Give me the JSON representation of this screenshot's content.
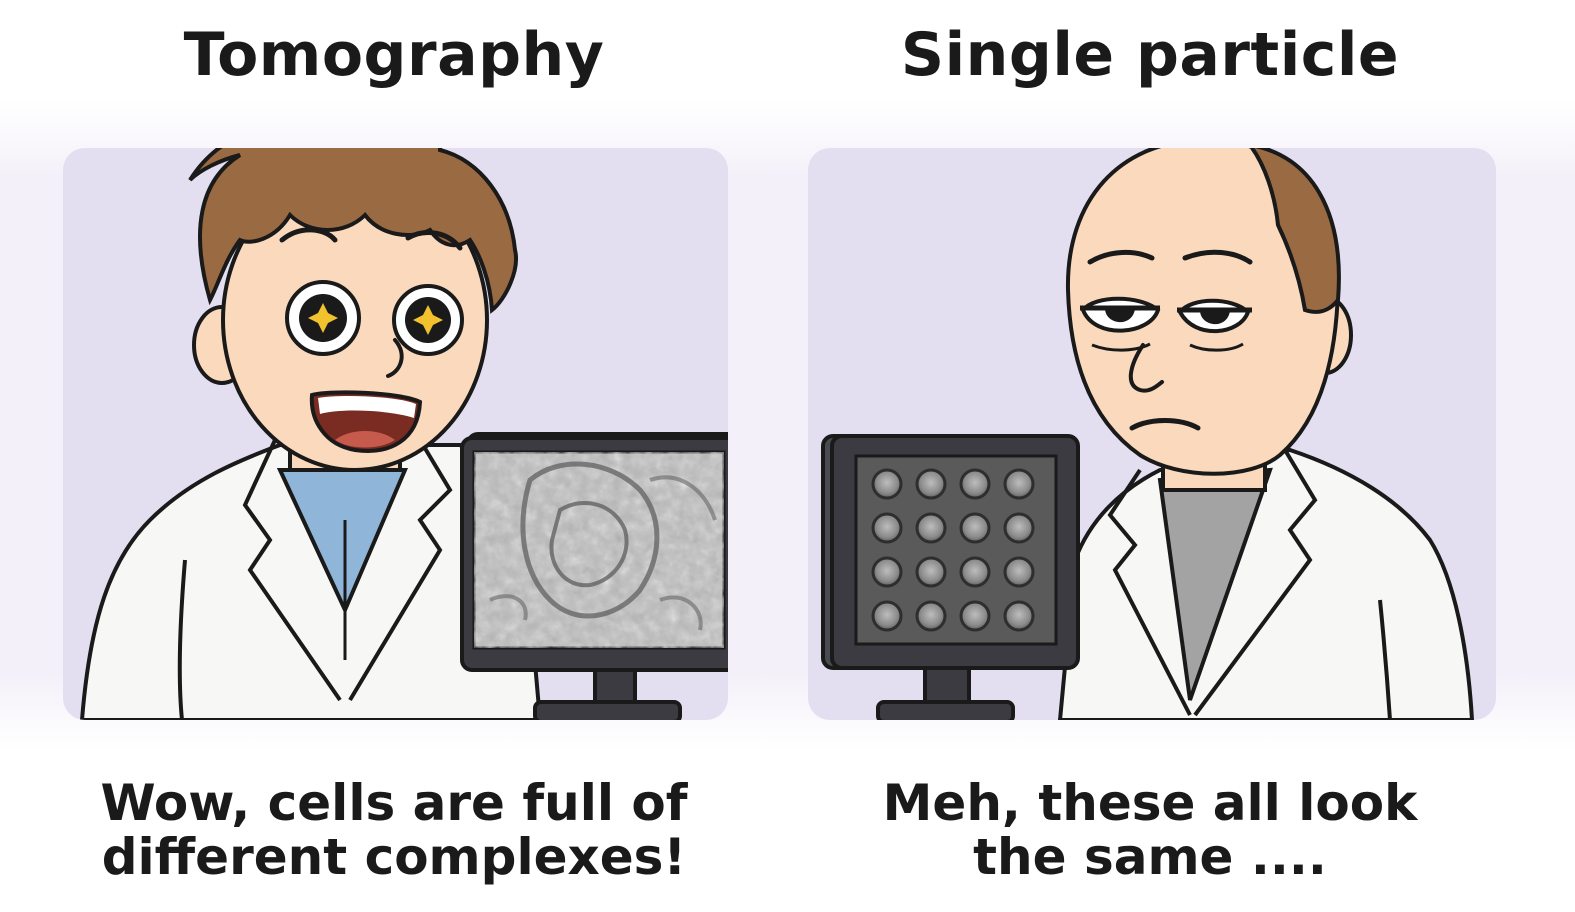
{
  "left_panel": {
    "title": "Tomography",
    "caption_line1": "Wow, cells are full of",
    "caption_line2": "different complexes!",
    "character": "excited-scientist",
    "screen": "tomogram-cell-image"
  },
  "right_panel": {
    "title": "Single particle",
    "caption_line1": "Meh, these all look",
    "caption_line2": "the same ....",
    "character": "bored-scientist",
    "screen": "particle-grid-image"
  },
  "colors": {
    "panel_bg": "#e3dff0",
    "skin": "#fad9bd",
    "hair": "#9a6a42",
    "coat": "#f7f7f5",
    "shirt_left": "#8fb6d8",
    "shirt_right": "#a3a3a3",
    "monitor": "#3b3b41",
    "sparkle": "#f2c12e"
  }
}
